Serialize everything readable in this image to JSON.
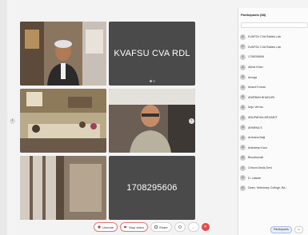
{
  "tiles": [
    {
      "label": ""
    },
    {
      "label": "KVAFSU CVA RDL"
    },
    {
      "label": ""
    },
    {
      "label": ""
    },
    {
      "label": ""
    },
    {
      "label": "1708295606"
    }
  ],
  "toolbar": {
    "unmute": "Unmute",
    "stop_video": "Stop video",
    "share": "Share"
  },
  "participants": {
    "title": "Participants (88)",
    "list": [
      {
        "initial": "K",
        "name": "KVAFSU CVA Rabies Lab"
      },
      {
        "initial": "K",
        "name": "KVAFSU CVA Rabies Lab"
      },
      {
        "initial": "1",
        "name": "1708295606"
      },
      {
        "initial": "A",
        "name": "Abhai Khan"
      },
      {
        "initial": "A",
        "name": "Amoga"
      },
      {
        "initial": "A",
        "name": "Anand Kumar"
      },
      {
        "initial": "A",
        "name": "ANIRBAN BHADURI"
      },
      {
        "initial": "A",
        "name": "Anju Verma"
      },
      {
        "initial": "A",
        "name": "ANUPADHA MEHARIT"
      },
      {
        "initial": "A",
        "name": "APARNA S"
      },
      {
        "initial": "A",
        "name": "Archana Baiji"
      },
      {
        "initial": "A",
        "name": "Arshdeep Kaur"
      },
      {
        "initial": "B",
        "name": "Bhoobumati"
      },
      {
        "initial": "C",
        "name": "Chhorn Ainda Devi"
      },
      {
        "initial": "D",
        "name": "D. Laiside"
      },
      {
        "initial": "D",
        "name": "Dean, Veterinary College, Ba..."
      }
    ],
    "footer_button": "Participants"
  }
}
